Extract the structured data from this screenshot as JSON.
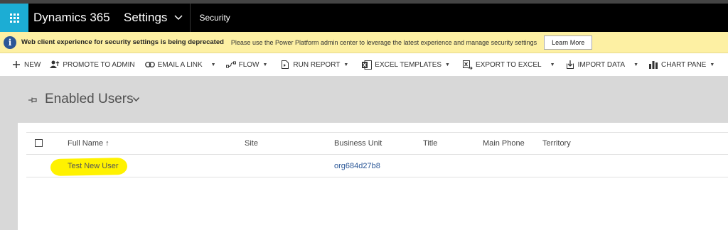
{
  "navbar": {
    "brand": "Dynamics 365",
    "area": "Settings",
    "subarea": "Security"
  },
  "notice": {
    "title": "Web client experience for security settings is being deprecated",
    "message": "Please use the Power Platform admin center to leverage the latest experience and manage security settings",
    "button": "Learn More"
  },
  "commands": {
    "new": "NEW",
    "promote": "PROMOTE TO ADMIN",
    "email_link": "EMAIL A LINK",
    "flow": "FLOW",
    "run_report": "RUN REPORT",
    "excel_templates": "EXCEL TEMPLATES",
    "export_excel": "EXPORT TO EXCEL",
    "import_data": "IMPORT DATA",
    "chart_pane": "CHART PANE",
    "more": "•••"
  },
  "view": {
    "title": "Enabled Users"
  },
  "grid": {
    "columns": {
      "full_name": "Full Name ↑",
      "site": "Site",
      "business_unit": "Business Unit",
      "title": "Title",
      "main_phone": "Main Phone",
      "territory": "Territory"
    },
    "rows": [
      {
        "full_name": "Test New User",
        "site": "",
        "business_unit": "org684d27b8",
        "title": "",
        "main_phone": "",
        "territory": ""
      }
    ]
  },
  "colors": {
    "accent": "#1cadd4",
    "notice_bg": "#fdf0a3",
    "link": "#2b5797",
    "highlight": "#fff200"
  }
}
